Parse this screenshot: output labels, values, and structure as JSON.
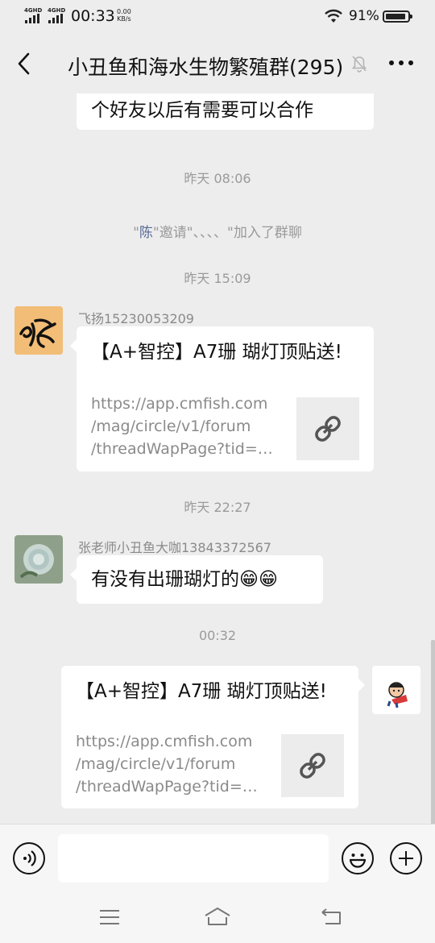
{
  "status_bar": {
    "network_1": "4GHD",
    "network_2": "4GHD",
    "time": "00:33",
    "speed_value": "0.00",
    "speed_unit": "KB/s",
    "battery": "91%"
  },
  "header": {
    "title": "小丑鱼和海水生物繁殖群(295)",
    "back_icon": "chevron-left-icon",
    "mute_icon": "bell-off-icon",
    "more_icon": "more-dots-icon"
  },
  "messages": {
    "m0_text": "个好友以后有需要可以合作",
    "ts1": "昨天 08:06",
    "sys_name": "陈",
    "sys_quote_open": "\"",
    "sys_rest": "\"邀请\"、、、、\"加入了群聊",
    "ts2": "昨天 15:09",
    "m1_sender": "飞扬15230053209",
    "m1_link_title": "【A+智控】A7珊 瑚灯顶贴送!",
    "m1_link_lines": [
      "https://app.cmfish.com",
      "/mag/circle/v1/forum",
      "/threadWapPage?tid=…"
    ],
    "ts3": "昨天 22:27",
    "m2_sender": "张老师小丑鱼大咖13843372567",
    "m2_text": "有没有出珊瑚灯的😁😁",
    "ts4": "00:32",
    "m3_link_title": "【A+智控】A7珊 瑚灯顶贴送!",
    "m3_link_lines": [
      "https://app.cmfish.com",
      "/mag/circle/v1/forum",
      "/threadWapPage?tid=…"
    ]
  },
  "input_bar": {
    "voice_icon": "voice-icon",
    "input_value": "",
    "emoji_icon": "emoji-icon",
    "plus_icon": "plus-icon"
  },
  "nav_bar": {
    "menu_icon": "menu-icon",
    "home_icon": "home-icon",
    "back_icon": "back-icon"
  }
}
